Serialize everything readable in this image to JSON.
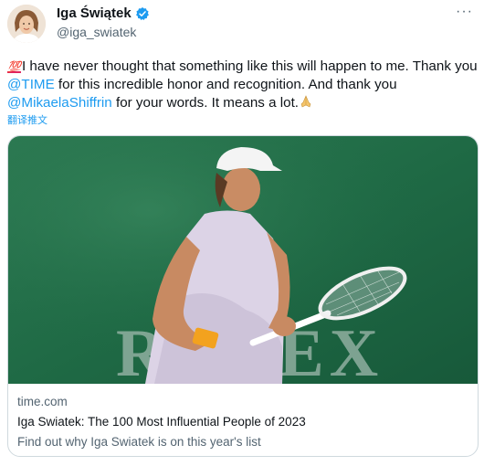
{
  "author": {
    "display_name": "Iga Świątek",
    "handle": "@iga_swiatek"
  },
  "tweet": {
    "emoji_100": "💯",
    "segments": [
      {
        "text": "I have never thought that something like this will happen to me. Thank you ",
        "type": "text"
      },
      {
        "text": "@TIME",
        "type": "mention"
      },
      {
        "text": " for this incredible honor and recognition. And thank you ",
        "type": "text"
      },
      {
        "text": "@MikaelaShiffrin",
        "type": "mention"
      },
      {
        "text": " for your words. It means a lot.",
        "type": "text"
      }
    ],
    "translate_label": "翻译推文"
  },
  "card": {
    "image_banner_text": "ROLEX",
    "domain": "time.com",
    "title": "Iga Swiatek: The 100 Most Influential People of 2023",
    "description": "Find out why Iga Swiatek is on this year's list"
  },
  "colors": {
    "link": "#1d9bf0",
    "verified": "#1d9bf0",
    "secondary_text": "#536471",
    "card_background_green": "#1f6a45"
  },
  "icons": [
    "verified-badge-icon",
    "more-options-icon",
    "hundred-points-emoji",
    "folded-hands-emoji"
  ]
}
